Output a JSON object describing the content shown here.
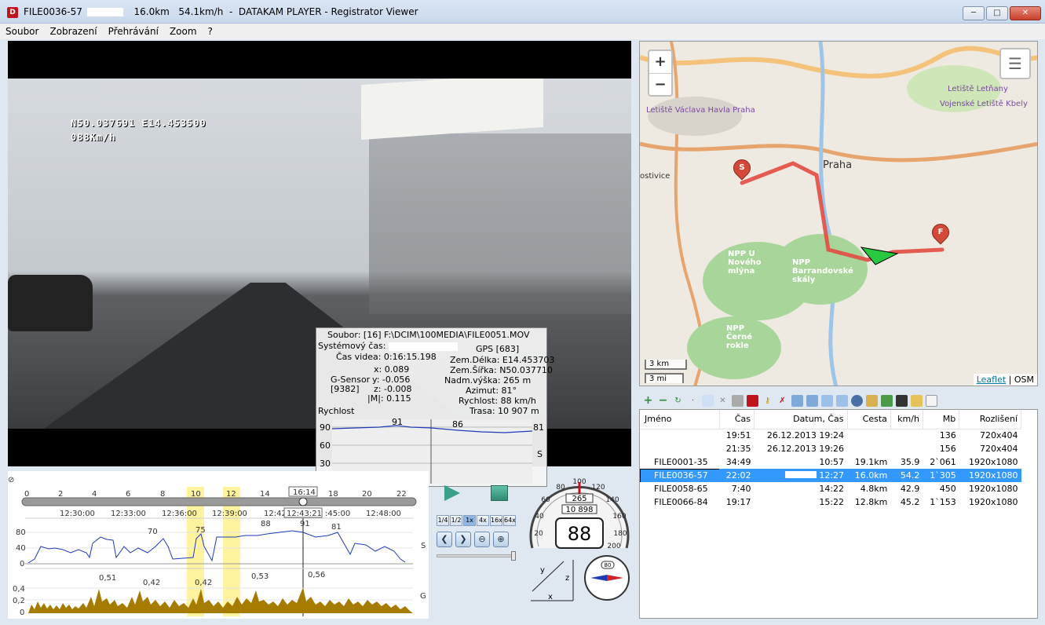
{
  "window": {
    "file": "FILE0036-57",
    "distance": "16.0km",
    "speed": "54.1km/h",
    "app": "DATAKAM PLAYER - Registrator Viewer"
  },
  "menu": [
    "Soubor",
    "Zobrazení",
    "Přehrávání",
    "Zoom",
    "?"
  ],
  "video": {
    "osd_line1": "N50.037691  E14.453500",
    "osd_line2": "088Km/h"
  },
  "info": {
    "file": "Soubor: [16] F:\\DCIM\\100MEDIA\\FILE0051.MOV",
    "system_time_label": "Systémový čas:",
    "video_time": "Čas videa: 0:16:15.198",
    "gps": "GPS [683]",
    "x": "x:  0.089",
    "y": "y: -0.056",
    "z": "z: -0.008",
    "m": "|M|:  0.115",
    "gsensor": "G-Sensor",
    "gsensor_count": "[9382]",
    "lon": "Zem.Délka: E14.453703",
    "lat": "Zem.Šířka: N50.037710",
    "alt": "Nadm.výška: 265 m",
    "azimuth": "Azimut: 81°",
    "speed": "Rychlost: 88 km/h",
    "track": "Trasa: 10 907 m",
    "chart_label": "Rychlost",
    "yticks": [
      "90",
      "60",
      "30",
      "0"
    ],
    "peaks": [
      "91",
      "86",
      "81"
    ],
    "s_label": "S"
  },
  "timeline": {
    "minutes": [
      "0",
      "2",
      "4",
      "6",
      "8",
      "10",
      "12",
      "14",
      "16:14",
      "18",
      "20",
      "22"
    ],
    "clock": [
      "12:30:00",
      "12:33:00",
      "12:36:00",
      "12:39:00",
      "12:42",
      "12:43:21",
      ":45:00",
      "12:48:00"
    ],
    "speed_yticks": [
      "80",
      "40",
      "0"
    ],
    "speed_peaks": [
      "70",
      "75",
      "88",
      "91",
      "81"
    ],
    "g_yticks": [
      "0,4",
      "0,2",
      "0"
    ],
    "g_peaks": [
      "0,51",
      "0,42",
      "0,42",
      "0,53",
      "0,56"
    ],
    "s_label": "S",
    "g_label": "G"
  },
  "controls": {
    "speeds": [
      "1/4",
      "1/2",
      "1x",
      "4x",
      "16x",
      "64x"
    ]
  },
  "gauge": {
    "speed": "88",
    "altitude": "265",
    "odometer": "10 898",
    "ticks": [
      "20",
      "40",
      "60",
      "80",
      "100",
      "120",
      "140",
      "160",
      "180",
      "200"
    ],
    "compass_heading": "80"
  },
  "map": {
    "zoom_in": "+",
    "zoom_out": "−",
    "scale_km": "3 km",
    "scale_mi": "3 mi",
    "attrib_link": "Leaflet",
    "attrib_rest": " | OSM",
    "city": "Praha",
    "label_ostivice": "ostivice",
    "label_barrandov": "NPP Barrandovské skály",
    "label_mlyna": "NPP U Nového mlýna",
    "label_roklje": "NPP Černé rokle",
    "label_airport": "Letiště Václava Havla Praha",
    "label_letnany": "Letiště Letňany",
    "label_kbely": "Vojenské Letiště Kbely",
    "start_marker": "S",
    "finish_marker": "F"
  },
  "files": {
    "columns": [
      "Jméno",
      "Čas",
      "Datum, Čas",
      "Cesta",
      "km/h",
      "Mb",
      "Rozlišení"
    ],
    "rows": [
      {
        "name": "",
        "time": "19:51",
        "date": "26.12.2013 19:24",
        "track": "",
        "speed": "",
        "mb": "136",
        "res": "720x404"
      },
      {
        "name": "",
        "time": "21:35",
        "date": "26.12.2013 19:26",
        "track": "",
        "speed": "",
        "mb": "156",
        "res": "720x404"
      },
      {
        "name": "FILE0001-35",
        "time": "34:49",
        "date": "10:57",
        "track": "19.1km",
        "speed": "35.9",
        "mb": "2`061",
        "res": "1920x1080"
      },
      {
        "name": "FILE0036-57",
        "time": "22:02",
        "date": "12:27",
        "track": "16.0km",
        "speed": "54.2",
        "mb": "1`305",
        "res": "1920x1080"
      },
      {
        "name": "FILE0058-65",
        "time": "7:40",
        "date": "14:22",
        "track": "4.8km",
        "speed": "42.9",
        "mb": "450",
        "res": "1920x1080"
      },
      {
        "name": "FILE0066-84",
        "time": "19:17",
        "date": "15:22",
        "track": "12.8km",
        "speed": "45.2",
        "mb": "1`153",
        "res": "1920x1080"
      }
    ]
  },
  "colors": {
    "route": "#e24b43",
    "speed_line": "#1f3ab8",
    "g_fill": "#a67c00",
    "selection": "#3399ff",
    "highlight": "#fff3a0"
  }
}
